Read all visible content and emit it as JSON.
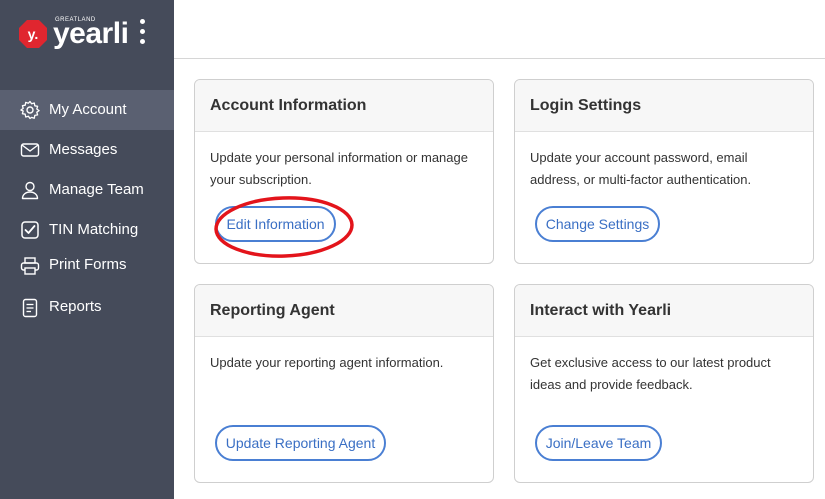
{
  "brand": {
    "small_text": "GREATLAND",
    "name": "yearli",
    "mark_letter": "y.",
    "accent_color": "#e0262f"
  },
  "sidebar": {
    "background": "#454b5a",
    "items": [
      {
        "label": "My Account",
        "icon": "gear-icon",
        "active": true
      },
      {
        "label": "Messages",
        "icon": "envelope-icon",
        "active": false
      },
      {
        "label": "Manage Team",
        "icon": "user-icon",
        "active": false
      },
      {
        "label": "TIN Matching",
        "icon": "checkbox-icon",
        "active": false
      },
      {
        "label": "Print Forms",
        "icon": "printer-icon",
        "active": false
      },
      {
        "label": "Reports",
        "icon": "document-icon",
        "active": false
      }
    ]
  },
  "cards": {
    "account_info": {
      "title": "Account Information",
      "description": "Update your personal information or manage your subscription.",
      "button": "Edit Information"
    },
    "login_settings": {
      "title": "Login Settings",
      "description": "Update your account password, email address, or multi-factor authentication.",
      "button": "Change Settings"
    },
    "reporting_agent": {
      "title": "Reporting Agent",
      "description": "Update your reporting agent information.",
      "button": "Update Reporting Agent"
    },
    "interact": {
      "title": "Interact with Yearli",
      "description": "Get exclusive access to our latest product ideas and provide feedback.",
      "button": "Join/Leave Team"
    }
  },
  "colors": {
    "button_border": "#4a7fd3",
    "annotation_circle": "#e3141b"
  }
}
